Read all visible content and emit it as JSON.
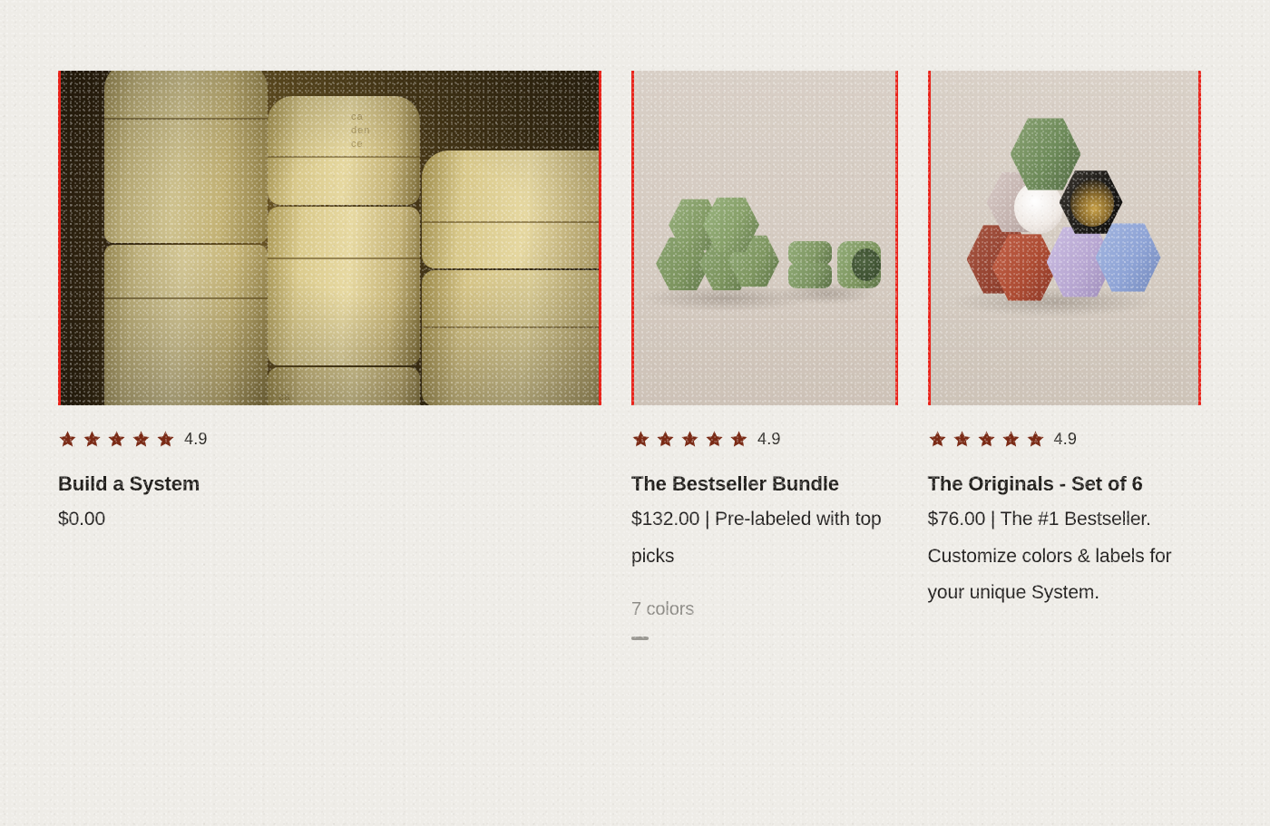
{
  "page": {
    "background_color": "#eeece7",
    "accent_border_color": "#e8231a",
    "star_color": "#7a2a15"
  },
  "products": [
    {
      "id": "build-a-system",
      "rating_value": "4.9",
      "stars": 5,
      "title": "Build a System",
      "description": "$0.00",
      "colors_label": "",
      "image": {
        "name": "gold-stacked-containers-photo",
        "alt": "Stacked cream-gold Cadence capsule containers in moody lighting",
        "brand_emboss": "cadence",
        "background_color": "#3b2c14"
      }
    },
    {
      "id": "the-bestseller-bundle",
      "rating_value": "4.9",
      "stars": 5,
      "title": "The Bestseller Bundle",
      "description": "$132.00 | Pre-labeled with top picks",
      "colors_label": "7 colors",
      "image": {
        "name": "green-hex-capsules-photo",
        "alt": "Pyramid of green hexagonal capsules beside two stacked pucks and one open capsule",
        "background_color": "#d5cbc2",
        "capsule_color": "#7c9463"
      }
    },
    {
      "id": "the-originals-set-of-6",
      "rating_value": "4.9",
      "stars": 5,
      "title": "The Originals - Set of 6",
      "description": "$76.00 | The #1 Bestseller. Customize colors & labels for your unique System.",
      "colors_label": "",
      "image": {
        "name": "multicolor-hex-capsules-photo",
        "alt": "Stack of six hexagonal capsules in green, blush, black, rust, lavender and blue",
        "background_color": "#d5cbc2",
        "capsule_colors": [
          "#6e8b5a",
          "#c9b8b6",
          "#1d1b18",
          "#b0503a",
          "#b8a7d2",
          "#8fa4d6"
        ]
      }
    }
  ]
}
